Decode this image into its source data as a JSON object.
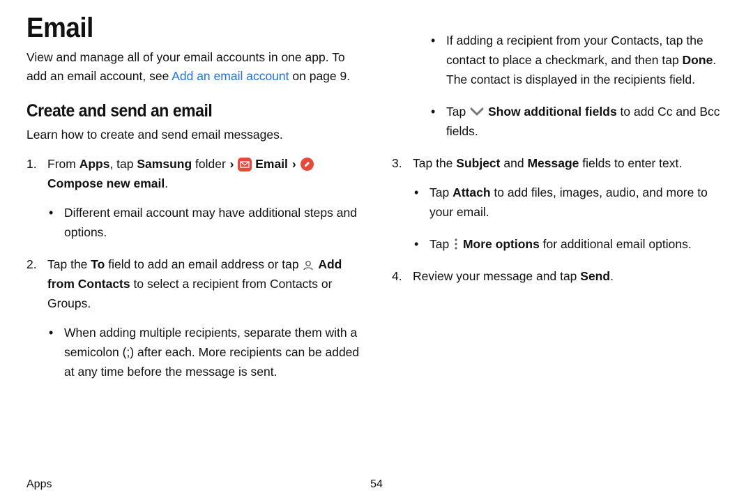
{
  "title": "Email",
  "intro_1": "View and manage all of your email accounts in one app. To add an email account, see ",
  "intro_link": "Add an email account",
  "intro_2": " on page 9.",
  "section_h2": "Create and send an email",
  "section_sub": "Learn how to create and send email messages.",
  "step1_a": "From ",
  "step1_apps": "Apps",
  "step1_b": ", tap ",
  "step1_samsung": "Samsung",
  "step1_c": " folder ",
  "chev": "›",
  "step1_email": "Email",
  "step1_compose": "Compose new email",
  "step1_period": ".",
  "step1_bullet": "Different email account may have additional steps and options.",
  "step2_a": "Tap the ",
  "step2_to": "To",
  "step2_b": " field to add an email address or tap ",
  "step2_addcontacts": "Add from Contacts",
  "step2_c": " to select a recipient from Contacts or Groups.",
  "step2_bullet1": "When adding multiple recipients, separate them with a semicolon (;) after each. More recipients can be added at any time before the message is sent.",
  "step2_bullet2_a": "If adding a recipient from your Contacts, tap the contact to place a checkmark, and then tap ",
  "step2_bullet2_done": "Done",
  "step2_bullet2_b": ". The contact is displayed in the recipients field.",
  "step2_bullet3_a": "Tap ",
  "step2_bullet3_showfields": "Show additional fields",
  "step2_bullet3_b": " to add Cc and Bcc fields.",
  "step3_a": "Tap the ",
  "step3_subject": "Subject",
  "step3_and": " and ",
  "step3_message": "Message",
  "step3_b": " fields to enter text.",
  "step3_bullet1_a": "Tap ",
  "step3_bullet1_attach": "Attach",
  "step3_bullet1_b": " to add files, images, audio, and more to your email.",
  "step3_bullet2_a": "Tap ",
  "step3_bullet2_more": "More options",
  "step3_bullet2_b": " for additional email options.",
  "step4_a": "Review your message and tap ",
  "step4_send": "Send",
  "step4_b": ".",
  "footer_section": "Apps",
  "footer_page": "54"
}
